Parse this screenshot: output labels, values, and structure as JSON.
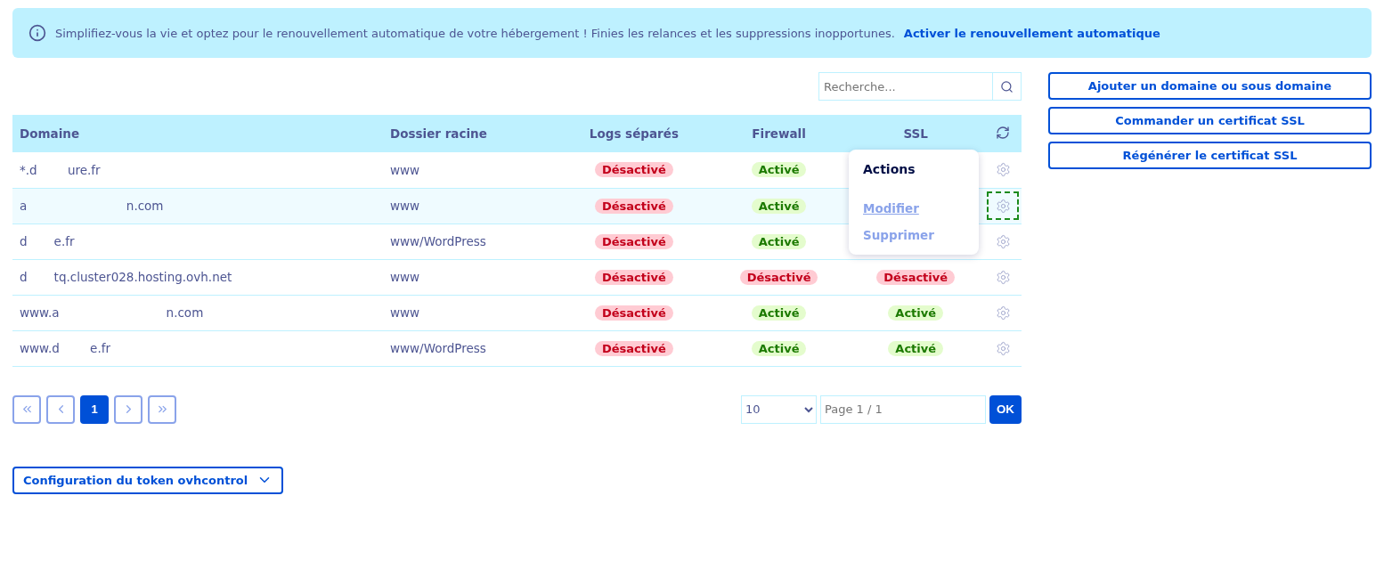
{
  "banner": {
    "text": "Simplifiez-vous la vie et optez pour le renouvellement automatique de votre hébergement ! Finies les relances et les suppressions inopportunes.",
    "link": "Activer le renouvellement automatique"
  },
  "search": {
    "placeholder": "Recherche..."
  },
  "side_buttons": [
    "Ajouter un domaine ou sous domaine",
    "Commander un certificat SSL",
    "Régénérer le certificat SSL"
  ],
  "table": {
    "columns": [
      "Domaine",
      "Dossier racine",
      "Logs séparés",
      "Firewall",
      "SSL"
    ],
    "rows": [
      {
        "domain": "*.d        ure.fr",
        "root": "www",
        "logs": {
          "label": "Désactivé",
          "on": false
        },
        "firewall": {
          "label": "Activé",
          "on": true
        },
        "ssl": null,
        "selected": false,
        "focused": false
      },
      {
        "domain": "a                          n.com",
        "root": "www",
        "logs": {
          "label": "Désactivé",
          "on": false
        },
        "firewall": {
          "label": "Activé",
          "on": true
        },
        "ssl": null,
        "selected": true,
        "focused": true
      },
      {
        "domain": "d       e.fr",
        "root": "www/WordPress",
        "logs": {
          "label": "Désactivé",
          "on": false
        },
        "firewall": {
          "label": "Activé",
          "on": true
        },
        "ssl": null,
        "selected": false,
        "focused": false
      },
      {
        "domain": "d       tq.cluster028.hosting.ovh.net",
        "root": "www",
        "logs": {
          "label": "Désactivé",
          "on": false
        },
        "firewall": {
          "label": "Désactivé",
          "on": false
        },
        "ssl": {
          "label": "Désactivé",
          "on": false
        },
        "selected": false,
        "focused": false
      },
      {
        "domain": "www.a                            n.com",
        "root": "www",
        "logs": {
          "label": "Désactivé",
          "on": false
        },
        "firewall": {
          "label": "Activé",
          "on": true
        },
        "ssl": {
          "label": "Activé",
          "on": true
        },
        "selected": false,
        "focused": false
      },
      {
        "domain": "www.d        e.fr",
        "root": "www/WordPress",
        "logs": {
          "label": "Désactivé",
          "on": false
        },
        "firewall": {
          "label": "Activé",
          "on": true
        },
        "ssl": {
          "label": "Activé",
          "on": true
        },
        "selected": false,
        "focused": false
      }
    ]
  },
  "actions_menu": {
    "title": "Actions",
    "items": [
      "Modifier",
      "Supprimer"
    ]
  },
  "pagination": {
    "pages": [
      {
        "label": "1",
        "selected": true
      }
    ],
    "page_size": "10",
    "page_input": {
      "placeholder": "Page 1 / 1"
    },
    "ok": "OK"
  },
  "token_toggle": {
    "label": "Configuration du token ovhcontrol",
    "expanded": false
  }
}
